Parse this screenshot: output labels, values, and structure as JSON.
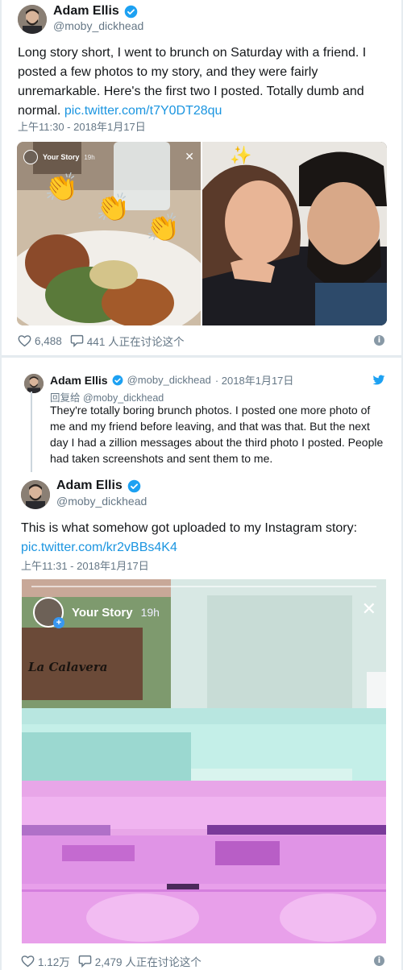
{
  "tweet1": {
    "author_name": "Adam Ellis",
    "author_handle": "@moby_dickhead",
    "text": "Long story short, I went to brunch on Saturday with a friend. I posted a few photos to my story, and they were fairly unremarkable. Here's the first two I posted. Totally dumb and normal.",
    "link": "pic.twitter.com/t7Y0DT28qu",
    "timestamp": "上午11:30 - 2018年1月17日",
    "story_label": "Your Story",
    "story_time": "19h",
    "likes": "6,488",
    "replies": "441 人正在讨论这个"
  },
  "reply": {
    "author_name": "Adam Ellis",
    "author_handle": "@moby_dickhead",
    "date": "· 2018年1月17日",
    "reply_to": "回复给 @moby_dickhead",
    "text": "They're totally boring brunch photos. I posted one more photo of me and my friend before leaving, and that was that. But the next day I had a zillion messages about the third photo I posted. People had taken screenshots and sent them to me."
  },
  "quoted": {
    "author_name": "Adam Ellis",
    "author_handle": "@moby_dickhead",
    "text": "This is what somehow got uploaded to my Instagram story:",
    "link": "pic.twitter.com/kr2vBBs4K4",
    "timestamp": "上午11:31 - 2018年1月17日",
    "story_label": "Your Story",
    "story_time": "19h",
    "sign_text": "La Calavera",
    "likes": "1.12万",
    "replies": "2,479 人正在讨论这个"
  },
  "icons": {
    "verified": "verified-badge-icon",
    "like": "heart-icon",
    "reply": "speech-bubble-icon",
    "info": "info-icon",
    "twitter": "twitter-bird-icon",
    "close": "close-icon"
  },
  "colors": {
    "link": "#1b95e0",
    "verified": "#1da1f2",
    "secondary_text": "#657786"
  }
}
